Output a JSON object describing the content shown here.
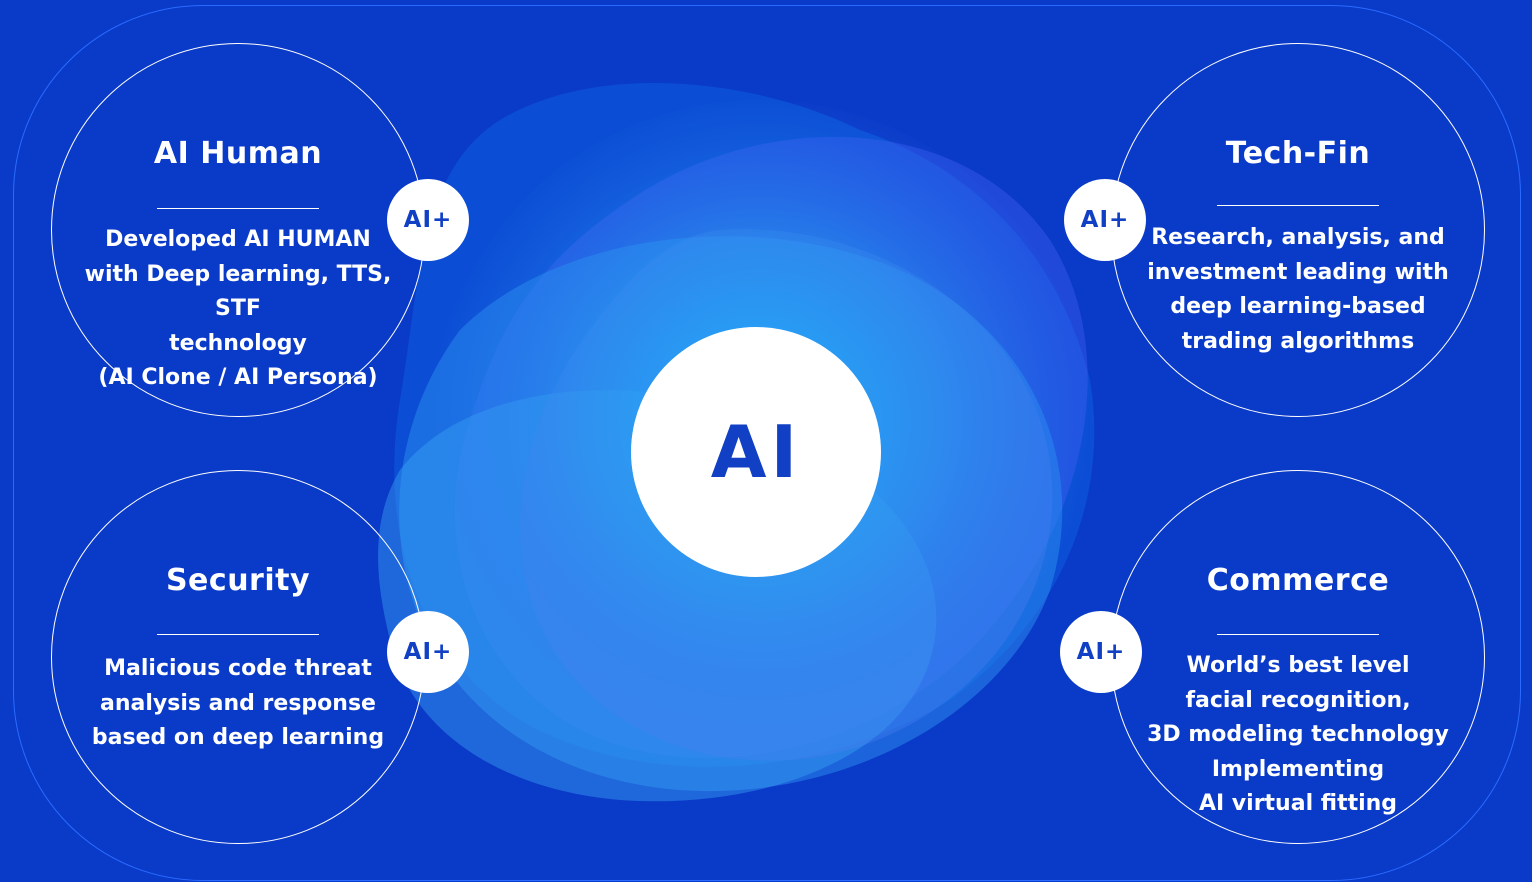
{
  "center": {
    "label": "AI"
  },
  "badge_label": "AI+",
  "cards": [
    {
      "title": "AI Human",
      "lines": [
        "Developed AI HUMAN",
        "with Deep learning, TTS, STF",
        "technology",
        "(AI Clone / AI Persona)"
      ]
    },
    {
      "title": "Tech-Fin",
      "lines": [
        "Research, analysis, and",
        "investment leading with",
        "deep learning-based",
        "trading algorithms"
      ]
    },
    {
      "title": "Security",
      "lines": [
        "Malicious code threat",
        "analysis and response",
        "based on deep learning"
      ]
    },
    {
      "title": "Commerce",
      "lines": [
        "World’s best level",
        "facial recognition,",
        "3D modeling technology",
        "Implementing",
        "AI virtual fitting"
      ]
    }
  ]
}
